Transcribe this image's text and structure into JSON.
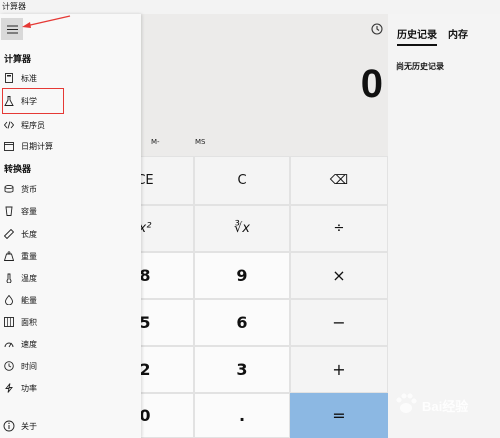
{
  "window": {
    "title": "计算器"
  },
  "history": {
    "tab_history": "历史记录",
    "tab_memory": "内存",
    "empty_text": "尚无历史记录"
  },
  "display": {
    "value": "0"
  },
  "memory": {
    "mminus": "M-",
    "ms": "MS"
  },
  "keys": {
    "ce": "CE",
    "c": "C",
    "backspace": "⌫",
    "square": "x²",
    "root": "∛x",
    "divide": "÷",
    "k8": "8",
    "k9": "9",
    "multiply": "×",
    "k5": "5",
    "k6": "6",
    "minus": "−",
    "k2": "2",
    "k3": "3",
    "plus": "+",
    "k0": "0",
    "dot": ".",
    "equals": "="
  },
  "drawer": {
    "calc_section": "计算器",
    "items": [
      {
        "label": "标准",
        "icon": "standard-calculator-icon"
      },
      {
        "label": "科学",
        "icon": "flask-icon"
      },
      {
        "label": "程序员",
        "icon": "code-icon"
      },
      {
        "label": "日期计算",
        "icon": "calendar-icon"
      }
    ],
    "converter_section": "转换器",
    "converters": [
      {
        "label": "货币",
        "icon": "currency-icon"
      },
      {
        "label": "容量",
        "icon": "volume-icon"
      },
      {
        "label": "长度",
        "icon": "ruler-icon"
      },
      {
        "label": "重量",
        "icon": "weight-icon"
      },
      {
        "label": "温度",
        "icon": "thermometer-icon"
      },
      {
        "label": "能量",
        "icon": "energy-icon"
      },
      {
        "label": "面积",
        "icon": "area-icon"
      },
      {
        "label": "速度",
        "icon": "speed-icon"
      },
      {
        "label": "时间",
        "icon": "clock-icon"
      },
      {
        "label": "功率",
        "icon": "power-icon"
      }
    ],
    "about": "关于"
  },
  "watermark": {
    "text": "Bai经验"
  },
  "colors": {
    "equals_key": "#8cb8e3",
    "highlight_box": "#e53935",
    "arrow": "#e53935"
  }
}
